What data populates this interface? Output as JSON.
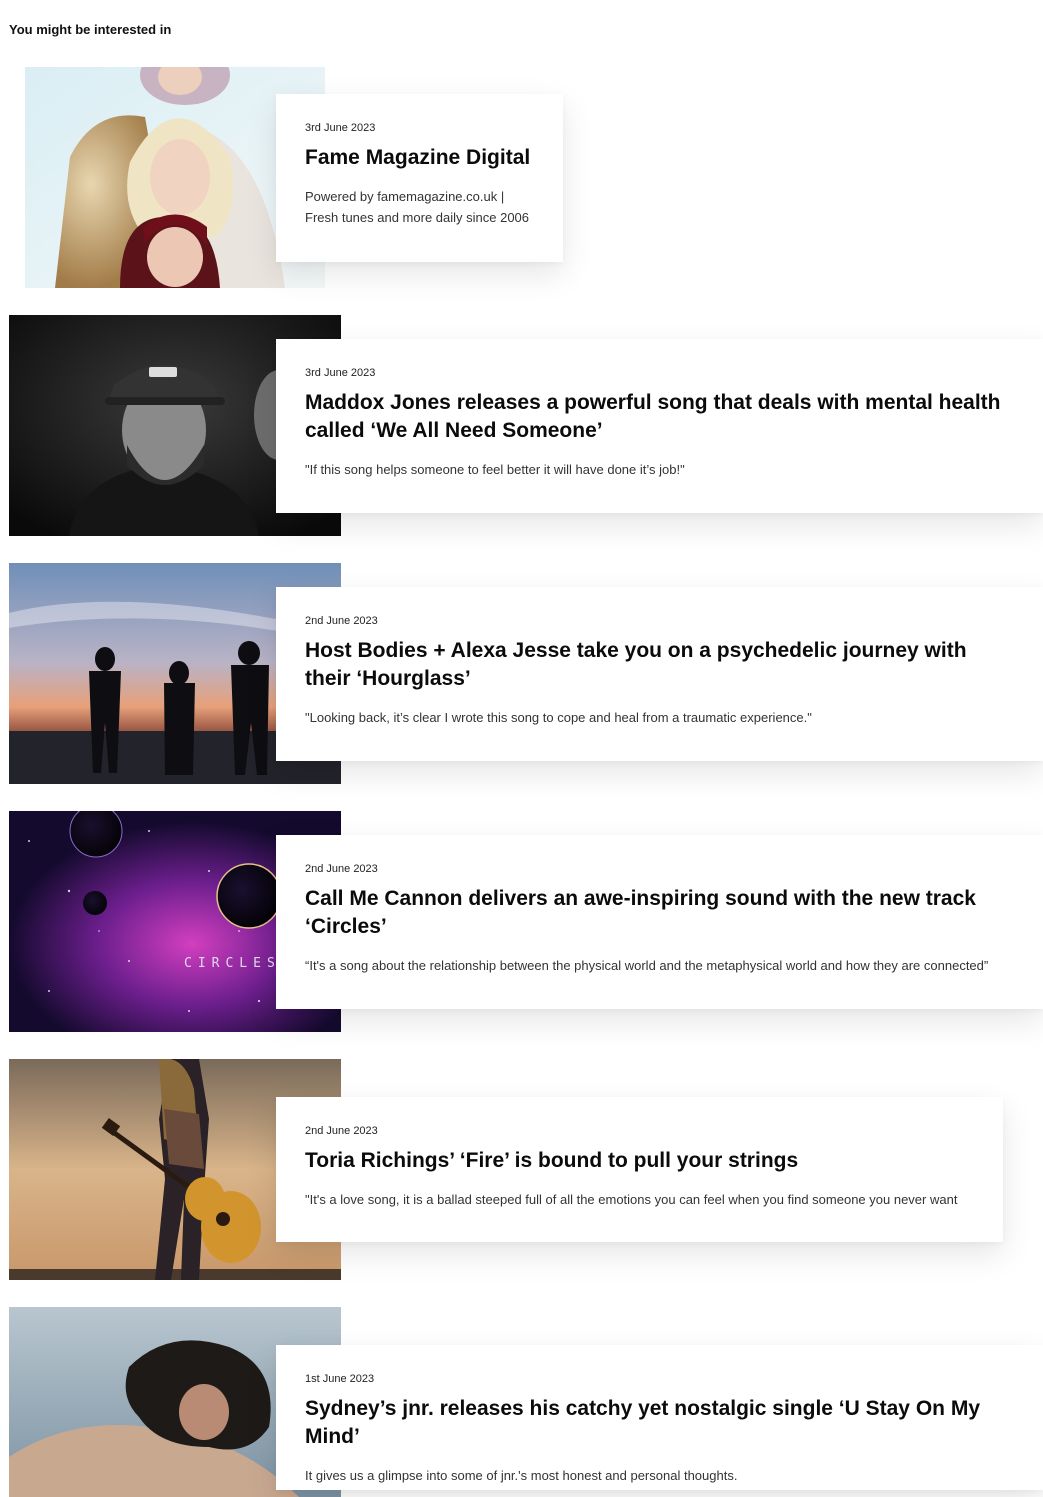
{
  "section": {
    "title": "You might be interested in"
  },
  "articles": [
    {
      "date": "3rd June 2023",
      "title": "Fame Magazine Digital",
      "excerpt_lines": [
        "Powered by famemagazine.co.uk |",
        "Fresh tunes and more daily since 2006"
      ],
      "image": "three-women-portrait"
    },
    {
      "date": "3rd June 2023",
      "title": "Maddox Jones releases a powerful song that deals with mental health called ‘We All Need Someone’",
      "excerpt": "\"If this song helps someone to feel better it will have done it’s job!\"",
      "image": "man-cap-beard-bw"
    },
    {
      "date": "2nd June 2023",
      "title": "Host Bodies + Alexa Jesse take you on a psychedelic journey with their ‘Hourglass’",
      "excerpt": "\"Looking back, it’s clear I wrote this song to cope and heal from a traumatic experience.\"",
      "image": "three-silhouettes-sunset-beach"
    },
    {
      "date": "2nd June 2023",
      "title": "Call Me Cannon delivers an awe-inspiring sound with the new track ‘Circles’",
      "excerpt": "“It's a song about the relationship between the physical world and the metaphysical world and how they are connected”",
      "image": "space-planets-circles-artwork",
      "image_text": "CIRCLES"
    },
    {
      "date": "2nd June 2023",
      "title": "Toria Richings’ ‘Fire’ is bound to pull your strings",
      "excerpt": "\"It's a love song, it is a ballad steeped full of all the emotions you can feel when you find someone you never want",
      "image": "woman-acoustic-guitar-sky"
    },
    {
      "date": "1st June 2023",
      "title": "Sydney’s jnr. releases his catchy yet nostalgic single ‘U Stay On My Mind’",
      "excerpt": "It gives us a glimpse into some of jnr.'s most honest and personal thoughts.",
      "image": "curly-hair-man-shoulder"
    }
  ]
}
